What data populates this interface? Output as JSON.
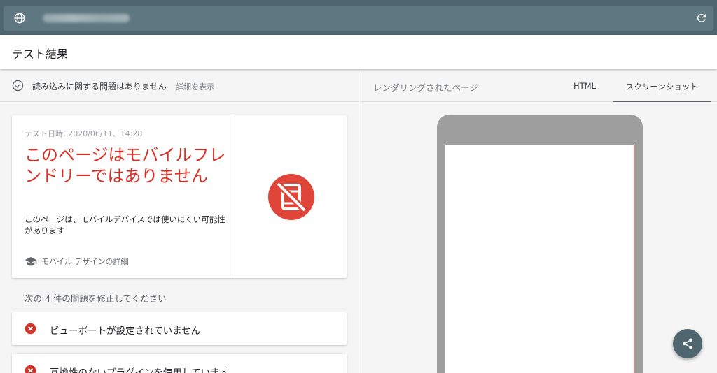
{
  "urlbar": {
    "url": "",
    "icons": [
      "globe-icon",
      "reload-icon"
    ]
  },
  "header": {
    "title": "テスト結果"
  },
  "status": {
    "text": "読み込みに関する問題はありません",
    "link": "詳細を表示"
  },
  "result": {
    "test_date": "テスト日時: 2020/06/11、14:28",
    "headline": "このページはモバイルフレンドリーではありません",
    "description": "このページは、モバイルデバイスでは使いにくい可能性があります",
    "learn_more": "モバイル デザインの詳細",
    "icon": "not-mobile-friendly-icon"
  },
  "issues": {
    "label": "次の 4 件の問題を修正してください",
    "items": [
      {
        "text": "ビューポートが設定されていません"
      },
      {
        "text": "互換性のないプラグインを使用しています"
      }
    ]
  },
  "rendered": {
    "label": "レンダリングされたページ",
    "tabs": [
      {
        "label": "HTML",
        "active": false
      },
      {
        "label": "スクリーンショット",
        "active": true
      }
    ]
  },
  "colors": {
    "topbar": "#4f6670",
    "error": "#d93025",
    "accent": "#5f6368"
  }
}
